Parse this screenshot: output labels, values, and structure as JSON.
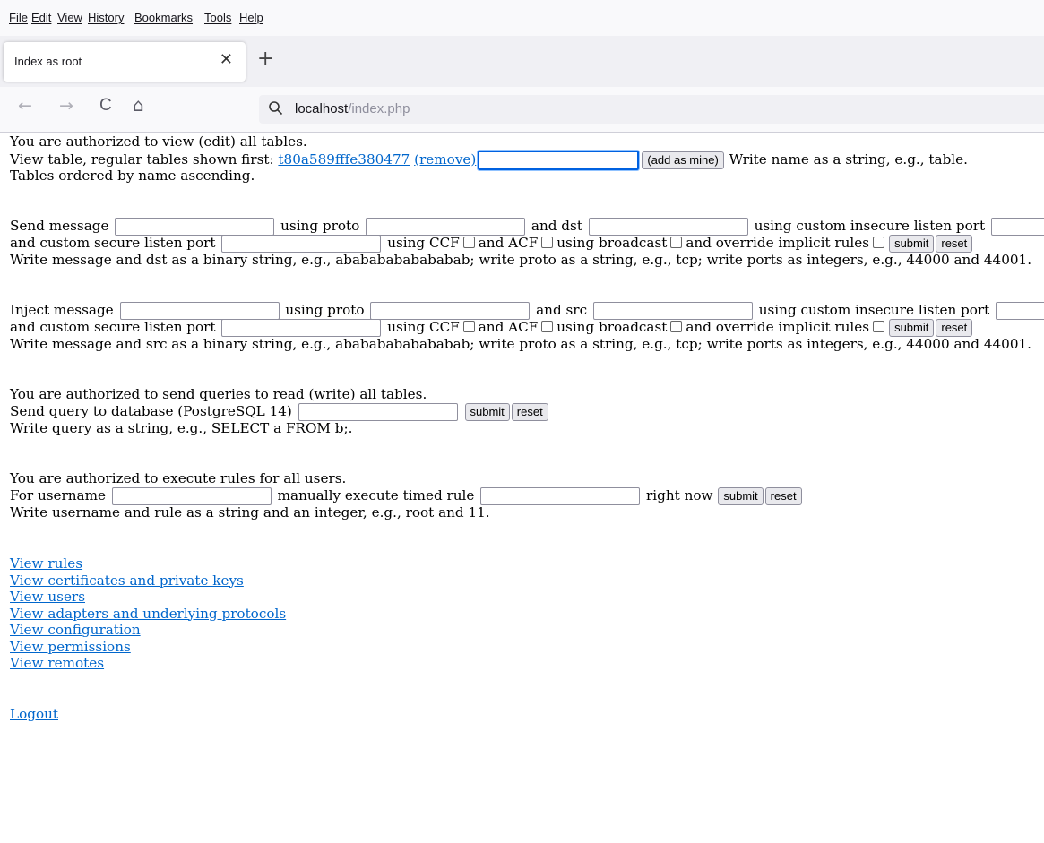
{
  "menu": [
    "File",
    "Edit",
    "View",
    "History",
    "Bookmarks",
    "Tools",
    "Help"
  ],
  "tab": {
    "title": "Index as root",
    "close_glyph": "✕",
    "new_tab_glyph": "+"
  },
  "nav": {
    "back": "←",
    "forward": "→",
    "reload": "C",
    "home": "⌂",
    "url_host": "localhost",
    "url_path": "/index.php"
  },
  "tables": {
    "auth": "You are authorized to view (edit) all tables.",
    "view_prefix": "View table, regular tables shown first:",
    "table_link": "t80a589fffe380477",
    "remove_link": "(remove)",
    "input_value": "",
    "add_button": "(add as mine)",
    "hint": "Write name as a string, e.g., table.",
    "order": "Tables ordered by name ascending."
  },
  "send": {
    "l1": "Send message",
    "l2": "using proto",
    "l3": "and dst",
    "l4": "using custom insecure listen port",
    "l5": "and custom secure listen port",
    "l6": "using CCF",
    "l7": "and ACF",
    "l8": "using broadcast",
    "l9": "and override implicit rules",
    "submit": "submit",
    "reset": "reset",
    "hint": "Write message and dst as a binary string, e.g., abababababababab; write proto as a string, e.g., tcp; write ports as integers, e.g., 44000 and 44001."
  },
  "inject": {
    "l1": "Inject message",
    "l2": "using proto",
    "l3": "and src",
    "l4": "using custom insecure listen port",
    "l5": "and custom secure listen port",
    "l6": "using CCF",
    "l7": "and ACF",
    "l8": "using broadcast",
    "l9": "and override implicit rules",
    "submit": "submit",
    "reset": "reset",
    "hint": "Write message and src as a binary string, e.g., abababababababab; write proto as a string, e.g., tcp; write ports as integers, e.g., 44000 and 44001."
  },
  "query": {
    "auth": "You are authorized to send queries to read (write) all tables.",
    "label": "Send query to database (PostgreSQL 14)",
    "submit": "submit",
    "reset": "reset",
    "hint": "Write query as a string, e.g., SELECT a FROM b;."
  },
  "rules": {
    "auth": "You are authorized to execute rules for all users.",
    "l1": "For username",
    "l2": "manually execute timed rule",
    "l3": "right now",
    "submit": "submit",
    "reset": "reset",
    "hint": "Write username and rule as a string and an integer, e.g., root and 11."
  },
  "links": [
    "View rules",
    "View certificates and private keys",
    "View users",
    "View adapters and underlying protocols",
    "View configuration",
    "View permissions",
    "View remotes"
  ],
  "logout": "Logout"
}
